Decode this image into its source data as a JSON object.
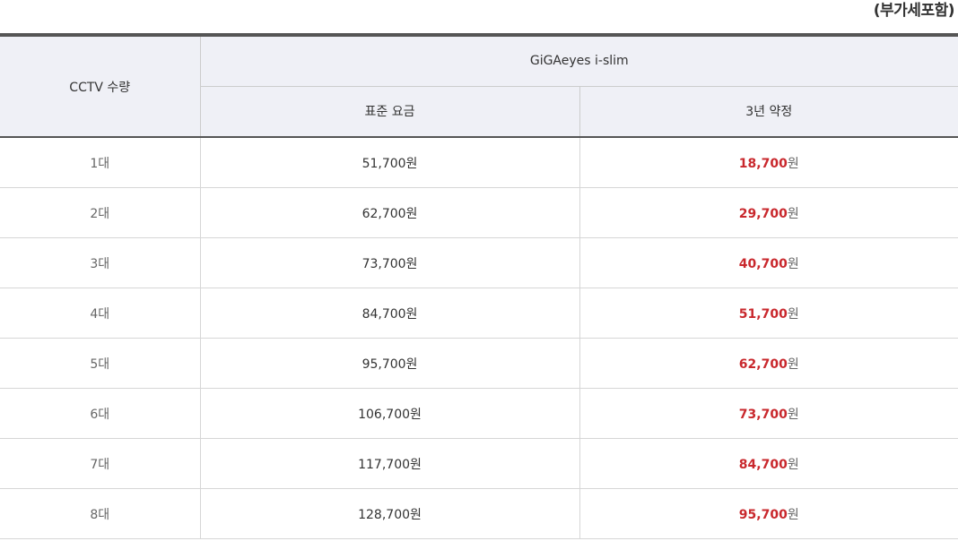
{
  "vat_note": "(부가세포함)",
  "table": {
    "qty_header": "CCTV 수량",
    "product_header": "GiGAeyes i-slim",
    "sub_headers": [
      "표준 요금",
      "3년 약정"
    ],
    "rows": [
      {
        "qty": "1대",
        "standard": "51,700원",
        "contract_amount": "18,700",
        "contract_unit": "원"
      },
      {
        "qty": "2대",
        "standard": "62,700원",
        "contract_amount": "29,700",
        "contract_unit": "원"
      },
      {
        "qty": "3대",
        "standard": "73,700원",
        "contract_amount": "40,700",
        "contract_unit": "원"
      },
      {
        "qty": "4대",
        "standard": "84,700원",
        "contract_amount": "51,700",
        "contract_unit": "원"
      },
      {
        "qty": "5대",
        "standard": "95,700원",
        "contract_amount": "62,700",
        "contract_unit": "원"
      },
      {
        "qty": "6대",
        "standard": "106,700원",
        "contract_amount": "73,700",
        "contract_unit": "원"
      },
      {
        "qty": "7대",
        "standard": "117,700원",
        "contract_amount": "84,700",
        "contract_unit": "원"
      },
      {
        "qty": "8대",
        "standard": "128,700원",
        "contract_amount": "95,700",
        "contract_unit": "원"
      }
    ]
  },
  "colors": {
    "header_bg": "#eff0f6",
    "accent_price": "#c9282d",
    "top_rule": "#555555",
    "text": "#333333"
  }
}
